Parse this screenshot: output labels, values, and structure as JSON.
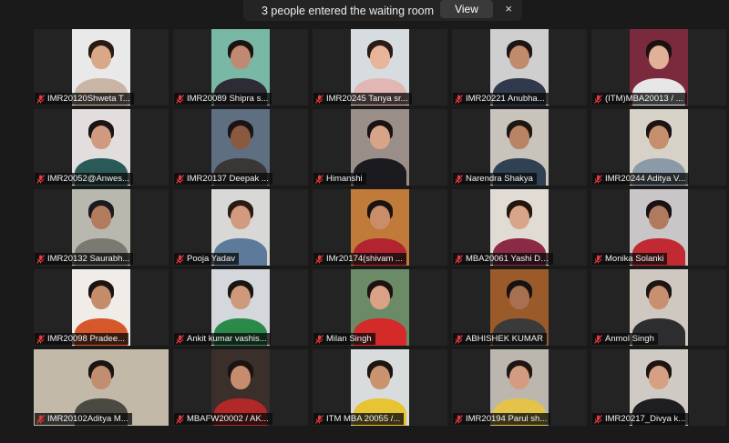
{
  "notification": {
    "message": "3 people entered the waiting room",
    "view_label": "View",
    "close_glyph": "×"
  },
  "participants": [
    {
      "name": "IMR20120Shweta T...",
      "wall": "#e9e9ea",
      "skin": "#d8a888",
      "hair": "#2a1a14",
      "shirt": "#c9b5a5",
      "muted": true
    },
    {
      "name": "IMR20089 Shipra s...",
      "wall": "#78b8a5",
      "skin": "#c08a72",
      "hair": "#1c1212",
      "shirt": "#2d2b33",
      "muted": true
    },
    {
      "name": "IMR20245 Tanya sr...",
      "wall": "#d6dce0",
      "skin": "#e8b49a",
      "hair": "#2b1b15",
      "shirt": "#e2b7b3",
      "muted": true
    },
    {
      "name": "IMR20221 Anubha...",
      "wall": "#cfcfd0",
      "skin": "#c08a6c",
      "hair": "#1d1514",
      "shirt": "#303a4c",
      "muted": true
    },
    {
      "name": "(ITM)MBA20013 / ...",
      "wall": "#7a2a3c",
      "skin": "#e0b098",
      "hair": "#1a1110",
      "shirt": "#e7e6e6",
      "muted": true
    },
    {
      "name": "IMR20052@Anwes...",
      "wall": "#e2dede",
      "skin": "#d09a80",
      "hair": "#1c1414",
      "shirt": "#2a5a58",
      "muted": true
    },
    {
      "name": "IMR20137 Deepak ...",
      "wall": "#5e6f82",
      "skin": "#8a5a40",
      "hair": "#1a1312",
      "shirt": "#3a3636",
      "muted": true
    },
    {
      "name": "Himanshi",
      "wall": "#9a8e88",
      "skin": "#d8a488",
      "hair": "#1a1212",
      "shirt": "#1a1a1f",
      "muted": true
    },
    {
      "name": "Narendra Shakya",
      "wall": "#c8c4bc",
      "skin": "#b98466",
      "hair": "#1e1613",
      "shirt": "#2f4152",
      "muted": true
    },
    {
      "name": "IMR20244 Aditya V...",
      "wall": "#d7d2c8",
      "skin": "#c58f6e",
      "hair": "#1b1412",
      "shirt": "#8a9aa8",
      "muted": true
    },
    {
      "name": "IMR20132 Saurabh...",
      "wall": "#b8b8ae",
      "skin": "#b47c5e",
      "hair": "#1b1b1f",
      "shirt": "#7b7a72",
      "muted": true
    },
    {
      "name": "Pooja Yadav",
      "wall": "#d8d8d6",
      "skin": "#d29a7e",
      "hair": "#2a1b15",
      "shirt": "#5e7a9b",
      "muted": true
    },
    {
      "name": "IMr20174(shivam ...",
      "wall": "#c07a3a",
      "skin": "#c98d6a",
      "hair": "#1a1211",
      "shirt": "#b22530",
      "muted": true
    },
    {
      "name": "MBA20061 Yashi Di...",
      "wall": "#e0dcd4",
      "skin": "#d9a588",
      "hair": "#23160f",
      "shirt": "#8a2a44",
      "muted": true
    },
    {
      "name": "Monika Solanki",
      "wall": "#c8c6c6",
      "skin": "#b07a5e",
      "hair": "#1a1212",
      "shirt": "#c22a33",
      "muted": true
    },
    {
      "name": "IMR20098 Pradee...",
      "wall": "#f0ece8",
      "skin": "#c58c6c",
      "hair": "#1d1412",
      "shirt": "#d6572a",
      "muted": true
    },
    {
      "name": "Ankit kumar vashis...",
      "wall": "#d4d8dc",
      "skin": "#cf9a7c",
      "hair": "#1b1512",
      "shirt": "#2b8a4a",
      "muted": true
    },
    {
      "name": "Milan Singh",
      "wall": "#6b8a66",
      "skin": "#d9a286",
      "hair": "#1c1211",
      "shirt": "#d42a2a",
      "muted": true
    },
    {
      "name": "ABHISHEK KUMAR",
      "wall": "#9a5a2a",
      "skin": "#a87050",
      "hair": "#161212",
      "shirt": "#3a3a3a",
      "muted": true
    },
    {
      "name": "Anmol Singh",
      "wall": "#cfc8c0",
      "skin": "#c88f70",
      "hair": "#1d1512",
      "shirt": "#2d2d2f",
      "muted": true
    },
    {
      "name": "IMR20102Aditya M...",
      "wall": "#c2b9a8",
      "skin": "#c28e70",
      "hair": "#1b1412",
      "shirt": "#4a4a42",
      "muted": true
    },
    {
      "name": "MBAFW20002 / AK...",
      "wall": "#3a2f2a",
      "skin": "#c58c6e",
      "hair": "#1a1311",
      "shirt": "#b12828",
      "muted": true
    },
    {
      "name": "ITM MBA 20055 /...",
      "wall": "#d8dcdc",
      "skin": "#c9936f",
      "hair": "#1c1512",
      "shirt": "#e6c433",
      "muted": true
    },
    {
      "name": "IMR20194 Parul sh...",
      "wall": "#bbb6ae",
      "skin": "#d39c80",
      "hair": "#1f1512",
      "shirt": "#e4c34a",
      "muted": true
    },
    {
      "name": "IMR20217_Divya k...",
      "wall": "#cfcac4",
      "skin": "#d5a084",
      "hair": "#1e1410",
      "shirt": "#1d1d22",
      "muted": true
    }
  ],
  "colors": {
    "background": "#1a1a1a",
    "tile": "#232323",
    "mute_icon": "#e33b3b",
    "label_text": "#f2f2f2"
  },
  "icons": {
    "mute": "microphone-muted-icon",
    "close": "close-icon"
  }
}
